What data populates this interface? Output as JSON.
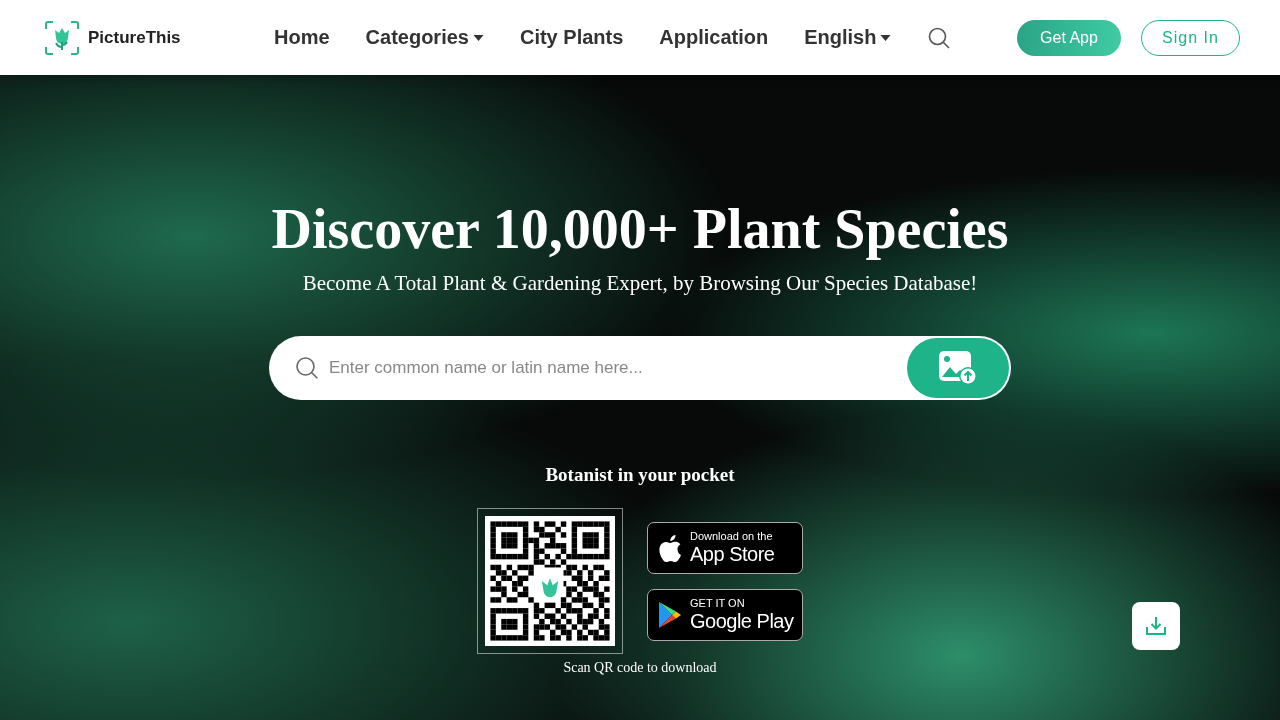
{
  "header": {
    "logo_text": "PictureThis",
    "nav": [
      {
        "label": "Home",
        "dropdown": false
      },
      {
        "label": "Categories",
        "dropdown": true
      },
      {
        "label": "City Plants",
        "dropdown": false
      },
      {
        "label": "Application",
        "dropdown": false
      },
      {
        "label": "English",
        "dropdown": true
      }
    ],
    "get_app": "Get App",
    "sign_in": "Sign In"
  },
  "hero": {
    "title": "Discover 10,000+ Plant Species",
    "subtitle": "Become A Total Plant & Gardening Expert, by Browsing Our Species Database!",
    "search": {
      "placeholder": "Enter common name or latin name here..."
    },
    "tagline": "Botanist in your pocket",
    "app_store": {
      "small": "Download on the",
      "big": "App Store"
    },
    "google_play": {
      "small": "GET IT ON",
      "big": "Google Play"
    },
    "qr_caption": "Scan QR code to download"
  }
}
